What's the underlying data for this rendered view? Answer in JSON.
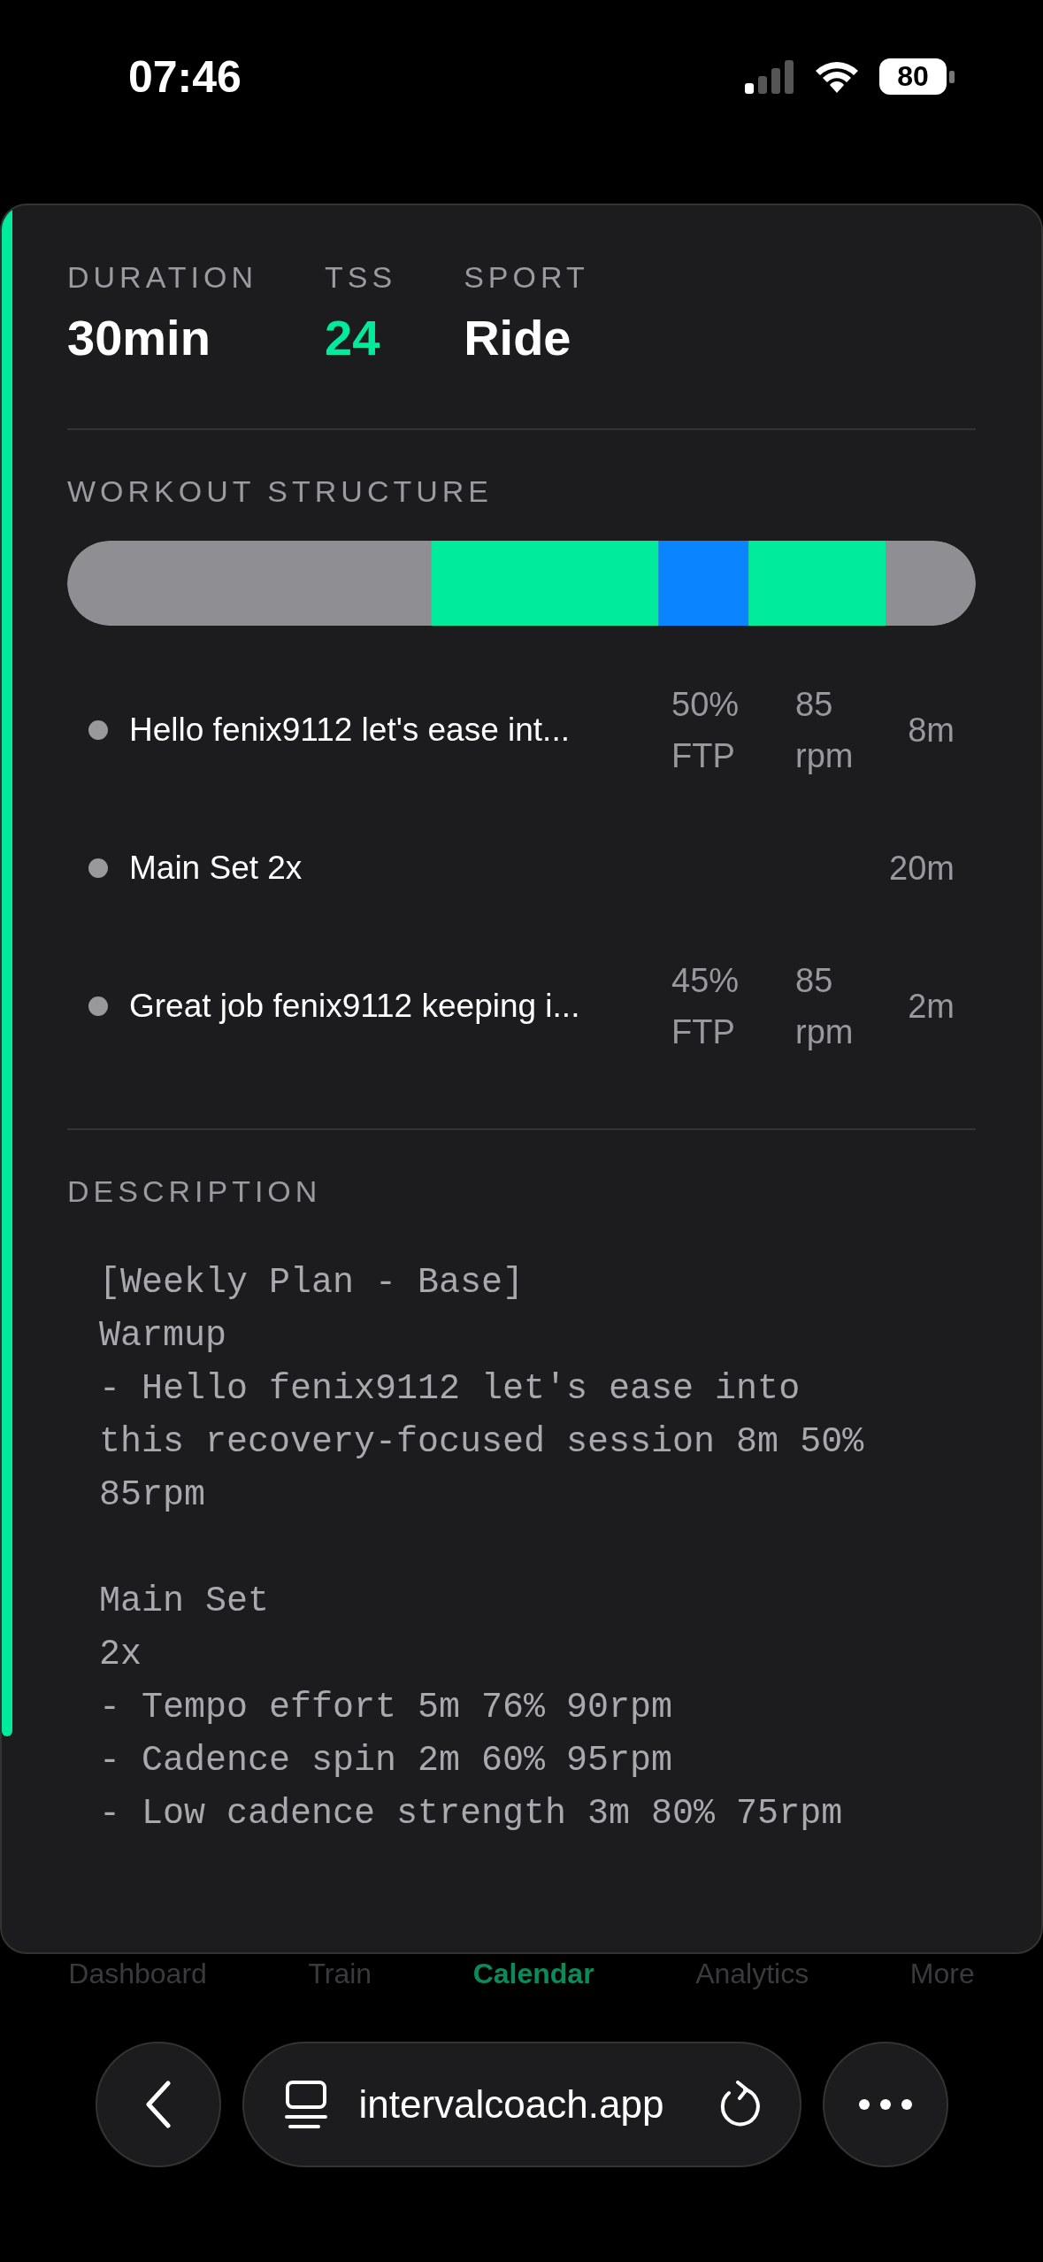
{
  "status_bar": {
    "time": "07:46",
    "battery": "80"
  },
  "stats": [
    {
      "label": "DURATION",
      "value": "30min",
      "accent": false
    },
    {
      "label": "TSS",
      "value": "24",
      "accent": true
    },
    {
      "label": "SPORT",
      "value": "Ride",
      "accent": false
    }
  ],
  "structure": {
    "title": "WORKOUT STRUCTURE"
  },
  "steps": [
    {
      "title": "Hello fenix9112 let's ease int...",
      "power": "50% FTP",
      "cadence": "85 rpm",
      "duration": "8m"
    },
    {
      "title": "Main Set 2x",
      "duration": "20m"
    },
    {
      "title": "Great job fenix9112 keeping i...",
      "power": "45% FTP",
      "cadence": "85 rpm",
      "duration": "2m"
    }
  ],
  "description": {
    "title": "DESCRIPTION",
    "text": "[Weekly Plan - Base]\nWarmup\n- Hello fenix9112 let's ease into this recovery-focused session 8m 50% 85rpm\n\nMain Set\n2x\n- Tempo effort 5m 76% 90rpm\n- Cadence spin 2m 60% 95rpm\n- Low cadence strength 3m 80% 75rpm"
  },
  "tab_bar": [
    {
      "label": "Dashboard",
      "selected": false
    },
    {
      "label": "Train",
      "selected": false
    },
    {
      "label": "Calendar",
      "selected": true
    },
    {
      "label": "Analytics",
      "selected": false
    },
    {
      "label": "More",
      "selected": false
    }
  ],
  "browser": {
    "url": "intervalcoach.app"
  }
}
